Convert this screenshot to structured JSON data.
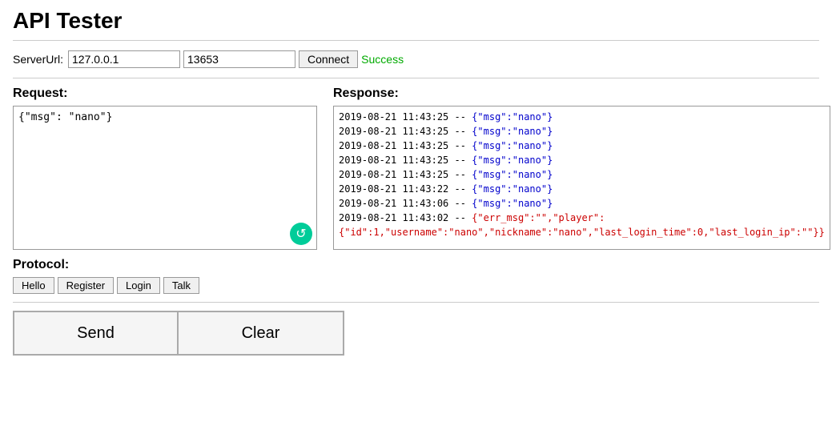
{
  "page": {
    "title": "API Tester"
  },
  "server": {
    "label": "ServerUrl:",
    "ip": "127.0.0.1",
    "port": "13653",
    "connect_label": "Connect",
    "status": "Success"
  },
  "request": {
    "section_label": "Request:",
    "content": "{\"msg\": \"nano\"}"
  },
  "response": {
    "section_label": "Response:",
    "lines": [
      {
        "timestamp": "2019-08-21 11:43:25 -- ",
        "data": "{\"msg\":\"nano\"}",
        "type": "normal"
      },
      {
        "timestamp": "2019-08-21 11:43:25 -- ",
        "data": "{\"msg\":\"nano\"}",
        "type": "normal"
      },
      {
        "timestamp": "2019-08-21 11:43:25 -- ",
        "data": "{\"msg\":\"nano\"}",
        "type": "normal"
      },
      {
        "timestamp": "2019-08-21 11:43:25 -- ",
        "data": "{\"msg\":\"nano\"}",
        "type": "normal"
      },
      {
        "timestamp": "2019-08-21 11:43:25 -- ",
        "data": "{\"msg\":\"nano\"}",
        "type": "normal"
      },
      {
        "timestamp": "2019-08-21 11:43:22 -- ",
        "data": "{\"msg\":\"nano\"}",
        "type": "normal"
      },
      {
        "timestamp": "2019-08-21 11:43:06 -- ",
        "data": "{\"msg\":\"nano\"}",
        "type": "normal"
      },
      {
        "timestamp": "2019-08-21 11:43:02 -- ",
        "data": "{\"err_msg\":\"\",\"player\":",
        "type": "red"
      },
      {
        "timestamp": "",
        "data": "{\"id\":1,\"username\":\"nano\",\"nickname\":\"nano\",\"last_login_time\":0,\"last_login_ip\":\"\"}}",
        "type": "red"
      }
    ]
  },
  "protocol": {
    "section_label": "Protocol:",
    "buttons": [
      "Hello",
      "Register",
      "Login",
      "Talk"
    ]
  },
  "actions": {
    "send_label": "Send",
    "clear_label": "Clear"
  },
  "icons": {
    "refresh": "↺"
  }
}
